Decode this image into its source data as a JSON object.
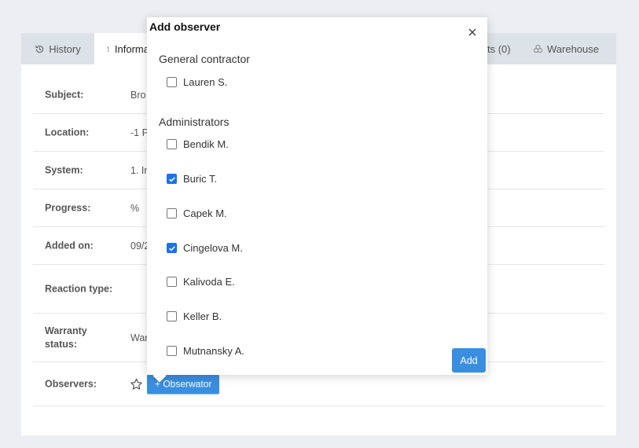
{
  "tabs": {
    "history": "History",
    "information": "Informa",
    "attachments": "ts (0)",
    "warehouse": "Warehouse"
  },
  "details": {
    "subject": {
      "label": "Subject:",
      "value": "Bro"
    },
    "location": {
      "label": "Location:",
      "value": "-1 P"
    },
    "system": {
      "label": "System:",
      "value": "1. In"
    },
    "progress": {
      "label": "Progress:",
      "value": "%"
    },
    "added_on": {
      "label": "Added on:",
      "value": "09/2"
    },
    "reaction_type": {
      "label": "Reaction type:",
      "value": ""
    },
    "warranty_status": {
      "label": "Warranty status:",
      "value": "War"
    },
    "observers": {
      "label": "Observers:",
      "add_button": "+ Obserwator"
    }
  },
  "popover": {
    "title": "Add observer",
    "groups": [
      {
        "title": "General contractor",
        "items": [
          {
            "name": "Lauren S.",
            "checked": false
          }
        ]
      },
      {
        "title": "Administrators",
        "items": [
          {
            "name": "Bendik M.",
            "checked": false
          },
          {
            "name": "Buric T.",
            "checked": true
          },
          {
            "name": "Capek M.",
            "checked": false
          },
          {
            "name": "Cingelova M.",
            "checked": true
          },
          {
            "name": "Kalivoda E.",
            "checked": false
          },
          {
            "name": "Keller B.",
            "checked": false
          },
          {
            "name": "Mutnansky A.",
            "checked": false
          }
        ]
      }
    ],
    "add_label": "Add"
  },
  "colors": {
    "accent": "#3a8ee0",
    "checkbox_checked": "#1a73e8",
    "tabbar": "#dde2e8",
    "background": "#eceef3"
  }
}
